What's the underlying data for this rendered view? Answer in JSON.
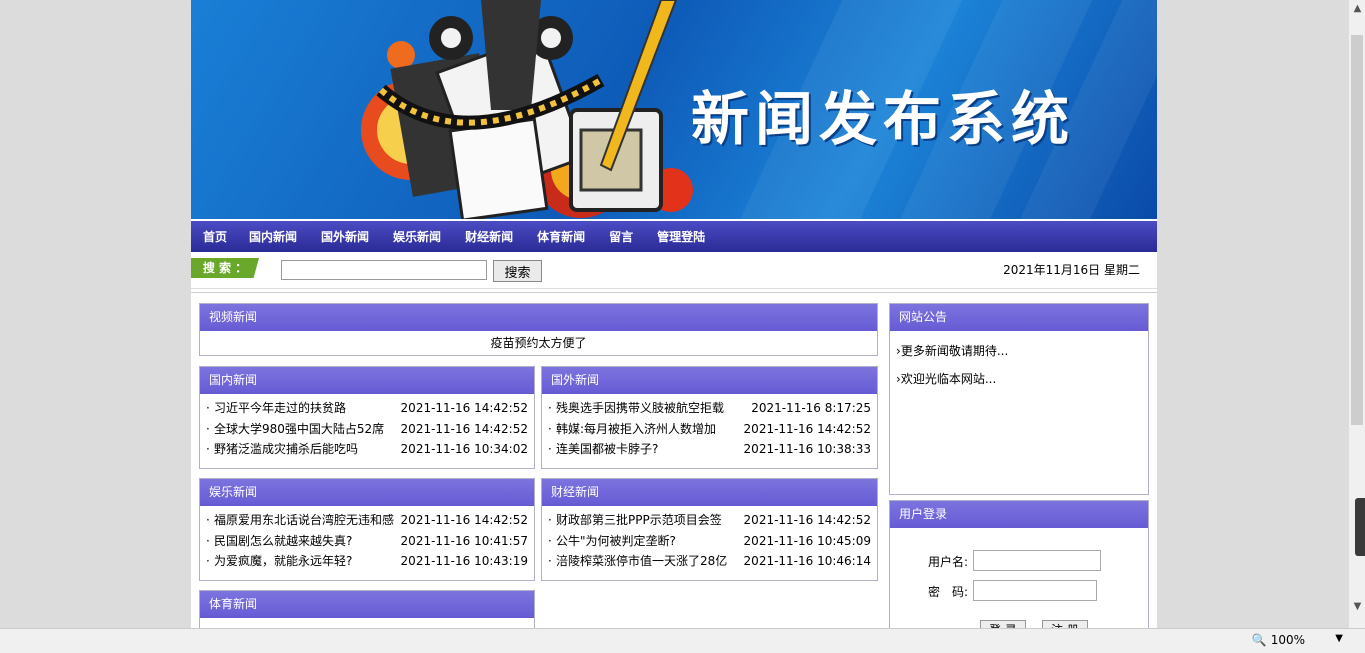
{
  "banner": {
    "title": "新闻发布系统"
  },
  "nav": [
    "首页",
    "国内新闻",
    "国外新闻",
    "娱乐新闻",
    "财经新闻",
    "体育新闻",
    "留言",
    "管理登陆"
  ],
  "search": {
    "label": "搜 索 ：",
    "button": "搜索",
    "value": "",
    "date": "2021年11月16日 星期二"
  },
  "video": {
    "title": "视频新闻",
    "item": "疫苗预约太方便了"
  },
  "domestic": {
    "title": "国内新闻",
    "items": [
      {
        "title": "习近平今年走过的扶贫路",
        "time": "2021-11-16 14:42:52"
      },
      {
        "title": "全球大学980强中国大陆占52席",
        "time": "2021-11-16 14:42:52"
      },
      {
        "title": "野猪泛滥成灾捕杀后能吃吗",
        "time": "2021-11-16 10:34:02"
      }
    ]
  },
  "foreign": {
    "title": "国外新闻",
    "items": [
      {
        "title": "残奥选手因携带义肢被航空拒载",
        "time": "2021-11-16 8:17:25"
      },
      {
        "title": "韩媒:每月被拒入济州人数增加",
        "time": "2021-11-16 14:42:52"
      },
      {
        "title": "连美国都被卡脖子?",
        "time": "2021-11-16 10:38:33"
      }
    ]
  },
  "entertainment": {
    "title": "娱乐新闻",
    "items": [
      {
        "title": "福原爱用东北话说台湾腔无违和感",
        "time": "2021-11-16 14:42:52"
      },
      {
        "title": "民国剧怎么就越来越失真?",
        "time": "2021-11-16 10:41:57"
      },
      {
        "title": "为爱疯魔，就能永远年轻?",
        "time": "2021-11-16 10:43:19"
      }
    ]
  },
  "finance": {
    "title": "财经新闻",
    "items": [
      {
        "title": "财政部第三批PPP示范项目会签",
        "time": "2021-11-16 14:42:52"
      },
      {
        "title": "公牛\"为何被判定垄断?",
        "time": "2021-11-16 10:45:09"
      },
      {
        "title": "涪陵榨菜涨停市值一天涨了28亿",
        "time": "2021-11-16 10:46:14"
      }
    ]
  },
  "sports": {
    "title": "体育新闻"
  },
  "notice": {
    "title": "网站公告",
    "items": [
      "更多新闻敬请期待...",
      "欢迎光临本网站..."
    ]
  },
  "login": {
    "title": "用户登录",
    "username_label": "用户名:",
    "password_label": "密　码:",
    "login_button": "登 录",
    "register_button": "注 册"
  },
  "browser": {
    "zoom": "100%"
  },
  "colors": {
    "nav": "#3a3ab0",
    "box_header": "#7067d9",
    "search_tag": "#6aa82c"
  }
}
